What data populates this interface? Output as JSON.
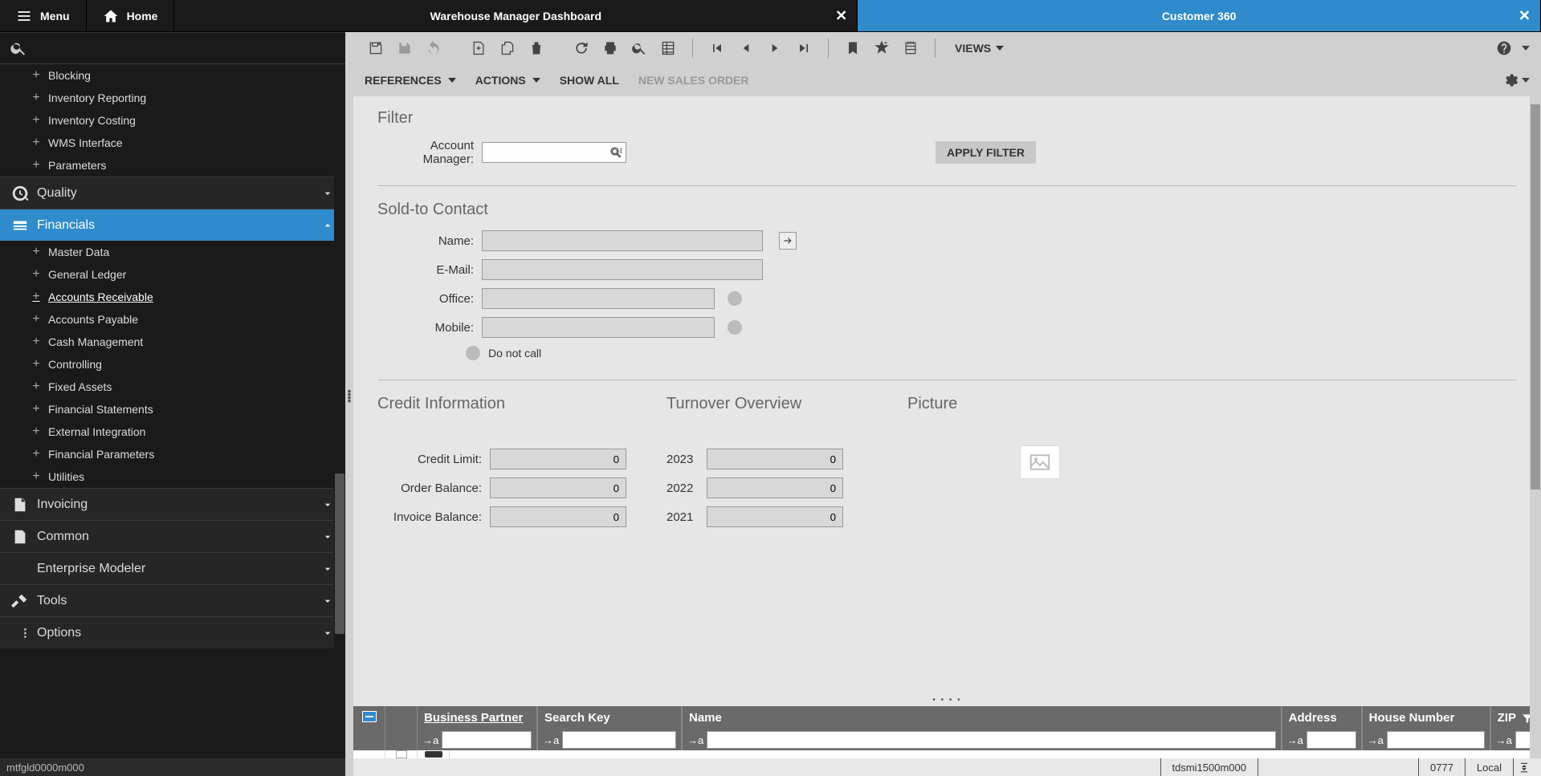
{
  "topbar": {
    "menu": "Menu",
    "home": "Home",
    "tab1": "Warehouse Manager Dashboard",
    "tab2": "Customer 360"
  },
  "sidebar": {
    "items_pre": [
      {
        "label": "Blocking"
      },
      {
        "label": "Inventory Reporting"
      },
      {
        "label": "Inventory Costing"
      },
      {
        "label": "WMS Interface"
      },
      {
        "label": "Parameters"
      }
    ],
    "quality": "Quality",
    "financials": "Financials",
    "financials_children": [
      {
        "label": "Master Data"
      },
      {
        "label": "General Ledger"
      },
      {
        "label": "Accounts Receivable",
        "active": true
      },
      {
        "label": "Accounts Payable"
      },
      {
        "label": "Cash Management"
      },
      {
        "label": "Controlling"
      },
      {
        "label": "Fixed Assets"
      },
      {
        "label": "Financial Statements"
      },
      {
        "label": "External Integration"
      },
      {
        "label": "Financial Parameters"
      },
      {
        "label": "Utilities"
      }
    ],
    "groups_post": [
      {
        "label": "Invoicing"
      },
      {
        "label": "Common"
      },
      {
        "label": "Enterprise Modeler"
      },
      {
        "label": "Tools"
      },
      {
        "label": "Options"
      }
    ],
    "status": "mtfgld0000m000"
  },
  "toolbar": {
    "views": "VIEWS"
  },
  "toolbar2": {
    "references": "REFERENCES",
    "actions": "ACTIONS",
    "show_all": "SHOW ALL",
    "new_order": "NEW SALES ORDER"
  },
  "form": {
    "filter_title": "Filter",
    "account_manager_label": "Account Manager:",
    "apply_filter": "APPLY FILTER",
    "sold_to_title": "Sold-to Contact",
    "name_label": "Name:",
    "email_label": "E-Mail:",
    "office_label": "Office:",
    "mobile_label": "Mobile:",
    "do_not_call": "Do not call",
    "credit_title": "Credit Information",
    "turnover_title": "Turnover Overview",
    "picture_title": "Picture",
    "credit_limit_label": "Credit Limit:",
    "credit_limit_value": "0",
    "order_balance_label": "Order Balance:",
    "order_balance_value": "0",
    "invoice_balance_label": "Invoice Balance:",
    "invoice_balance_value": "0",
    "y2023": "2023",
    "y2023v": "0",
    "y2022": "2022",
    "y2022v": "0",
    "y2021": "2021",
    "y2021v": "0"
  },
  "grid": {
    "col_bp": "Business Partner",
    "col_sk": "Search Key",
    "col_name": "Name",
    "col_addr": "Address",
    "col_house": "House Number",
    "col_zip": "ZIP"
  },
  "status": {
    "session": "tdsmi1500m000",
    "code": "0777",
    "local": "Local"
  }
}
